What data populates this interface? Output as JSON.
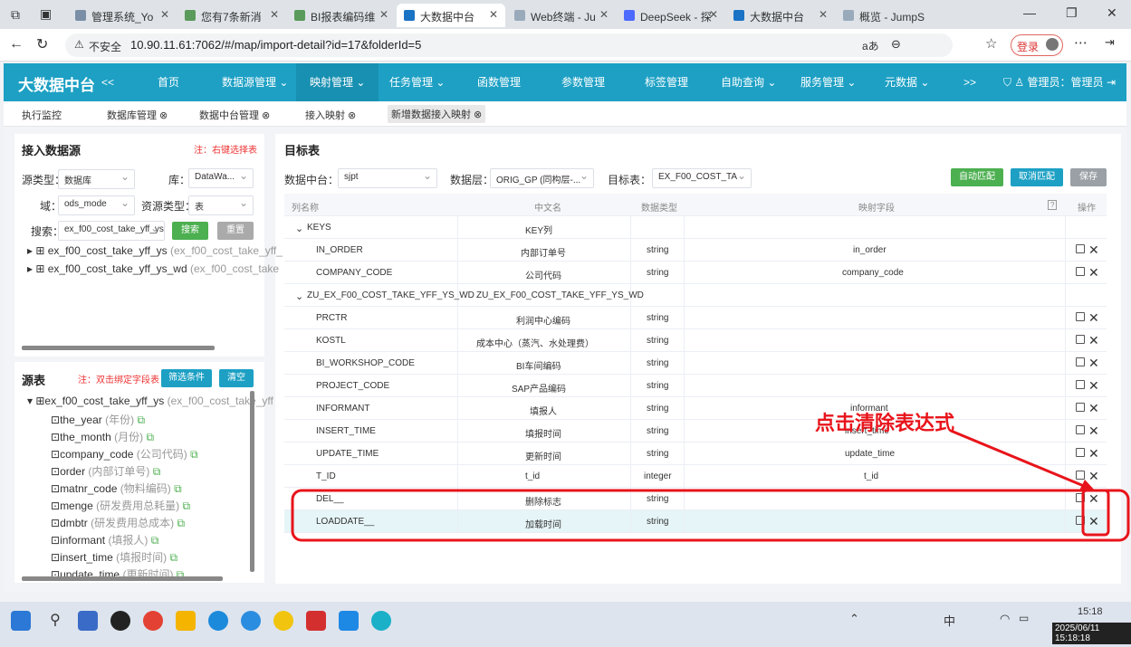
{
  "browser": {
    "tabs": [
      {
        "title": "管理系统_Yo",
        "active": false
      },
      {
        "title": "您有7条新消",
        "active": false
      },
      {
        "title": "BI报表编码维",
        "active": false
      },
      {
        "title": "大数据中台",
        "active": true
      },
      {
        "title": "Web终端 - Ju",
        "active": false
      },
      {
        "title": "DeepSeek - 探",
        "active": false
      },
      {
        "title": "大数据中台",
        "active": false
      },
      {
        "title": "概览 - JumpS",
        "active": false
      }
    ],
    "insecure": "不安全",
    "url": "10.90.11.61:7062/#/map/import-detail?id=17&folderId=5",
    "login": "登录"
  },
  "nav": {
    "logo": "大数据中台",
    "collapse": "<<",
    "expand": ">>",
    "items": [
      "首页",
      "数据源管理",
      "映射管理",
      "任务管理",
      "函数管理",
      "参数管理",
      "标签管理",
      "自助查询",
      "服务管理",
      "元数据"
    ],
    "user": "管理员：管理员"
  },
  "subtabs": [
    "执行监控",
    "数据库管理",
    "数据中台管理",
    "接入映射",
    "新增数据接入映射"
  ],
  "left": {
    "title": "接入数据源",
    "hint": "注：右键选择表",
    "src_type_label": "源类型：",
    "src_type": "数据库",
    "lib_label": "库：",
    "lib": "DataWa...",
    "domain_label": "域：",
    "domain": "ods_mode",
    "res_type_label": "资源类型：",
    "res_type": "表",
    "search_label": "搜索：",
    "search": "ex_f00_cost_take_yff_ys",
    "search_btn": "搜索",
    "reset_btn": "重置",
    "tables": [
      {
        "name": "ex_f00_cost_take_yff_ys",
        "alias": "(ex_f00_cost_take_yff_"
      },
      {
        "name": "ex_f00_cost_take_yff_ys_wd",
        "alias": "(ex_f00_cost_take"
      }
    ]
  },
  "source": {
    "title": "源表",
    "hint": "注：双击绑定字段表",
    "filter_btn": "筛选条件",
    "clear_btn": "清空",
    "root": {
      "name": "ex_f00_cost_take_yff_ys",
      "alias": "(ex_f00_cost_take_yff"
    },
    "fields": [
      {
        "name": "the_year",
        "alias": "(年份)"
      },
      {
        "name": "the_month",
        "alias": "(月份)"
      },
      {
        "name": "company_code",
        "alias": "(公司代码)"
      },
      {
        "name": "order",
        "alias": "(内部订单号)"
      },
      {
        "name": "matnr_code",
        "alias": "(物料编码)"
      },
      {
        "name": "menge",
        "alias": "(研发费用总耗量)"
      },
      {
        "name": "dmbtr",
        "alias": "(研发费用总成本)"
      },
      {
        "name": "informant",
        "alias": "(填报人)"
      },
      {
        "name": "insert_time",
        "alias": "(填报时间)"
      },
      {
        "name": "update_time",
        "alias": "(更新时间)"
      }
    ]
  },
  "target": {
    "title": "目标表",
    "platform_label": "数据中台：",
    "platform": "sjpt",
    "layer_label": "数据层：",
    "layer": "ORIG_GP (同构层-...",
    "table_label": "目标表：",
    "table": "EX_F00_COST_TA",
    "auto_btn": "自动匹配",
    "cancel_btn": "取消匹配",
    "save_btn": "保存",
    "columns": [
      "列名称",
      "中文名",
      "数据类型",
      "映射字段",
      "?",
      "操作"
    ],
    "rows": [
      {
        "name": "KEYS",
        "cn": "KEY列",
        "type": "",
        "map": "",
        "group": true
      },
      {
        "name": "IN_ORDER",
        "cn": "内部订单号",
        "type": "string",
        "map": "in_order"
      },
      {
        "name": "COMPANY_CODE",
        "cn": "公司代码",
        "type": "string",
        "map": "company_code"
      },
      {
        "name": "ZU_EX_F00_COST_TAKE_YFF_YS_WD",
        "cn": "ZU_EX_F00_COST_TAKE_YFF_YS_WD",
        "type": "",
        "map": "",
        "group": true
      },
      {
        "name": "PRCTR",
        "cn": "利润中心编码",
        "type": "string",
        "map": ""
      },
      {
        "name": "KOSTL",
        "cn": "成本中心（蒸汽、水处理费）",
        "type": "string",
        "map": ""
      },
      {
        "name": "BI_WORKSHOP_CODE",
        "cn": "BI车间编码",
        "type": "string",
        "map": ""
      },
      {
        "name": "PROJECT_CODE",
        "cn": "SAP产品编码",
        "type": "string",
        "map": ""
      },
      {
        "name": "INFORMANT",
        "cn": "填报人",
        "type": "string",
        "map": "informant"
      },
      {
        "name": "INSERT_TIME",
        "cn": "填报时间",
        "type": "string",
        "map": "insert_time"
      },
      {
        "name": "UPDATE_TIME",
        "cn": "更新时间",
        "type": "string",
        "map": "update_time"
      },
      {
        "name": "T_ID",
        "cn": "t_id",
        "type": "integer",
        "map": "t_id"
      },
      {
        "name": "DEL__",
        "cn": "删除标志",
        "type": "string",
        "map": ""
      },
      {
        "name": "LOADDATE__",
        "cn": "加载时间",
        "type": "string",
        "map": ""
      }
    ]
  },
  "annotation": {
    "text": "点击清除表达式",
    "color": "#e8141b"
  },
  "taskbar": {
    "time": "15:18",
    "datetime": "2025/06/11 15:18:18",
    "ime": "中"
  }
}
